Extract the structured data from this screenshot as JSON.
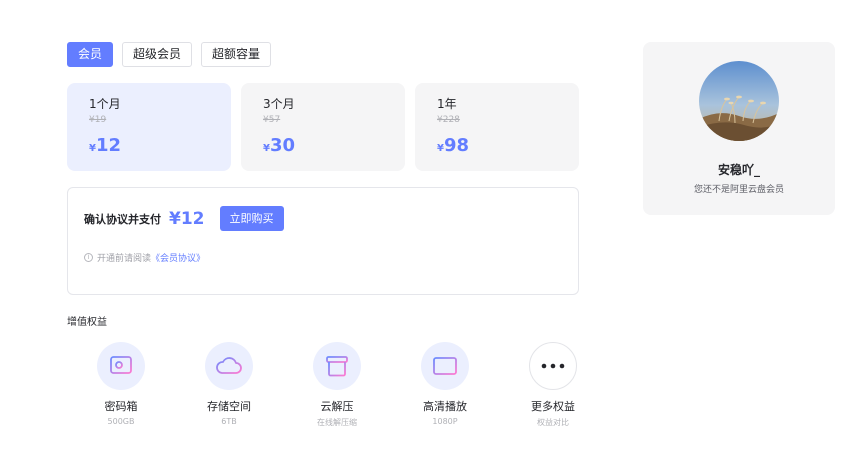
{
  "tabs": [
    {
      "label": "会员"
    },
    {
      "label": "超级会员"
    },
    {
      "label": "超额容量"
    }
  ],
  "plans": [
    {
      "period": "1个月",
      "original": "¥19",
      "currency": "¥",
      "price": "12"
    },
    {
      "period": "3个月",
      "original": "¥57",
      "currency": "¥",
      "price": "30"
    },
    {
      "period": "1年",
      "original": "¥228",
      "currency": "¥",
      "price": "98"
    }
  ],
  "purchase": {
    "confirm_label": "确认协议并支付",
    "price": "¥12",
    "buy_button": "立即购买",
    "info_icon": "i",
    "notice_text": "开通前请阅读",
    "notice_link": "《会员协议》"
  },
  "benefits": {
    "title": "增值权益",
    "items": [
      {
        "name": "密码箱",
        "sub": "500GB",
        "icon": "safe-icon"
      },
      {
        "name": "存储空间",
        "sub": "6TB",
        "icon": "cloud-icon"
      },
      {
        "name": "云解压",
        "sub": "在线解压缩",
        "icon": "archive-box-icon"
      },
      {
        "name": "高清播放",
        "sub": "1080P",
        "icon": "video-player-icon"
      },
      {
        "name": "更多权益",
        "sub": "权益对比",
        "icon": "more-dots-icon"
      }
    ]
  },
  "user": {
    "username": "安稳吖_",
    "status": "您还不是阿里云盘会员"
  },
  "colors": {
    "accent": "#637dff",
    "selected_plan_bg": "#ebeffe",
    "card_bg": "#f5f5f6"
  }
}
